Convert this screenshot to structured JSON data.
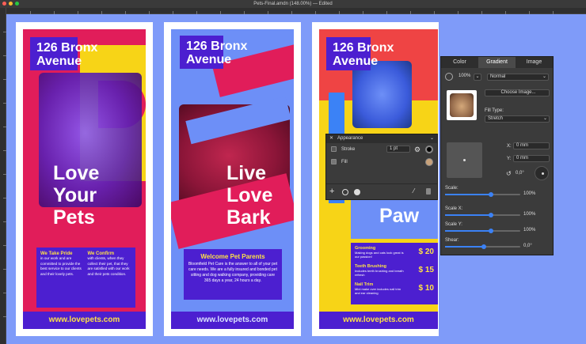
{
  "window": {
    "title": "Pets-Final.amdn (148.00%) — Edited"
  },
  "cards": [
    {
      "address": "126 Bronx Avenue",
      "headline": "Love\nYour\nPets",
      "col1_title": "We Take Pride",
      "col1_text": "in our work and are committed to provide the best service to our clients and their lovely pets.",
      "col2_title": "We Confirm",
      "col2_text": "with clients, when they collect their pet, that they are satisfied with our work and their pets condition.",
      "url": "www.lovepets.com"
    },
    {
      "address": "126 Bronx Avenue",
      "headline": "Live\nLove\nBark",
      "box_title": "Welcome Pet Parents",
      "box_text": "Bloomfield Pet Care is the answer to all of your pet care needs. We are a fully insured and bonded pet sitting and dog walking company, providing care 365 days a year, 24 hours a day.",
      "url": "www.lovepets.com"
    },
    {
      "address": "126 Bronx Avenue",
      "headline": "Paw",
      "services": [
        {
          "name": "Grooming",
          "desc": "Making dogs and cats look great is our passion!",
          "price": "$ 20"
        },
        {
          "name": "Teeth Brushing",
          "desc": "Includes teeth brushing and breath refresh",
          "price": "$ 15"
        },
        {
          "name": "Nail Trim",
          "desc": "Mini make over includes nail trim and ear cleaning",
          "price": "$ 10"
        }
      ],
      "url": "www.lovepets.com"
    }
  ],
  "appearance": {
    "title": "Appearance",
    "stroke_label": "Stroke",
    "stroke_width": "1 pt",
    "fill_label": "Fill"
  },
  "fill_panel": {
    "tabs": [
      "Color",
      "Gradient",
      "Image"
    ],
    "opacity": "100%",
    "blend_mode": "Normal",
    "choose_image": "Choose Image...",
    "fill_type_label": "Fill Type:",
    "fill_type": "Stretch",
    "x_label": "X:",
    "x_value": "0 mm",
    "y_label": "Y:",
    "y_value": "0 mm",
    "rotation": "0,0°",
    "scale_label": "Scale:",
    "scale_value": "100%",
    "scale_x_label": "Scale X:",
    "scale_x_value": "100%",
    "scale_y_label": "Scale Y:",
    "scale_y_value": "100%",
    "shear_label": "Shear:",
    "shear_value": "0,0°"
  },
  "colors": {
    "pink": "#e11d5a",
    "purple": "#4c1fd0",
    "yellow": "#fde047",
    "blue": "#6d8ff7"
  }
}
